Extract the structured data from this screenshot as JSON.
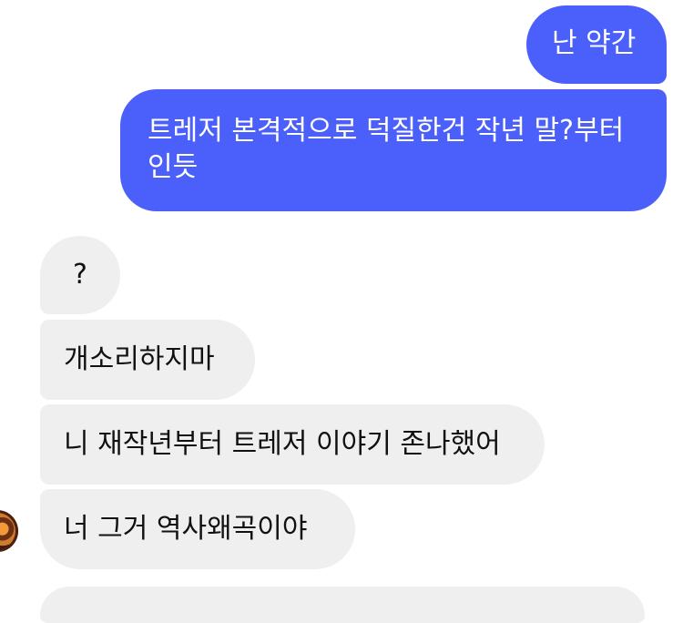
{
  "messages": [
    {
      "side": "outgoing",
      "text": "난 약간"
    },
    {
      "side": "outgoing",
      "text": "트레저 본격적으로 덕질한건 작년 말?부터인듯"
    },
    {
      "side": "incoming",
      "text": "?"
    },
    {
      "side": "incoming",
      "text": "개소리하지마"
    },
    {
      "side": "incoming",
      "text": "니 재작년부터 트레저 이야기 존나했어"
    },
    {
      "side": "incoming",
      "text": "너 그거 역사왜곡이야"
    },
    {
      "side": "incoming",
      "text": ""
    }
  ],
  "colors": {
    "outgoing_bubble": "#4b5ffa",
    "incoming_bubble": "#efefef",
    "outgoing_text": "#ffffff",
    "incoming_text": "#111111"
  },
  "avatar": {
    "icon": "profile-avatar"
  }
}
